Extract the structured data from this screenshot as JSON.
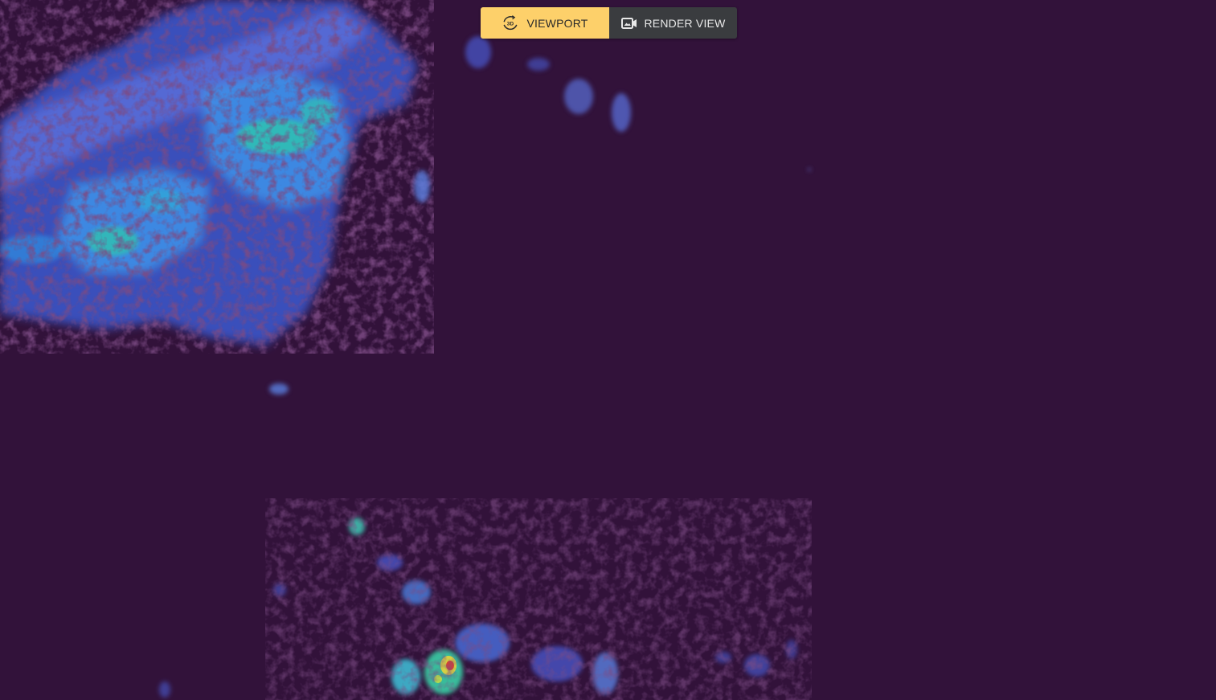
{
  "toolbar": {
    "viewport_label": "VIEWPORT",
    "viewport_icon": "3d-rotate-icon",
    "render_label": "RENDER VIEW",
    "render_icon": "video-camera-icon",
    "active_mode": "viewport"
  },
  "colors": {
    "background": "#32123a",
    "active_button": "#fdd06a",
    "inactive_button": "#3a3c3f"
  }
}
